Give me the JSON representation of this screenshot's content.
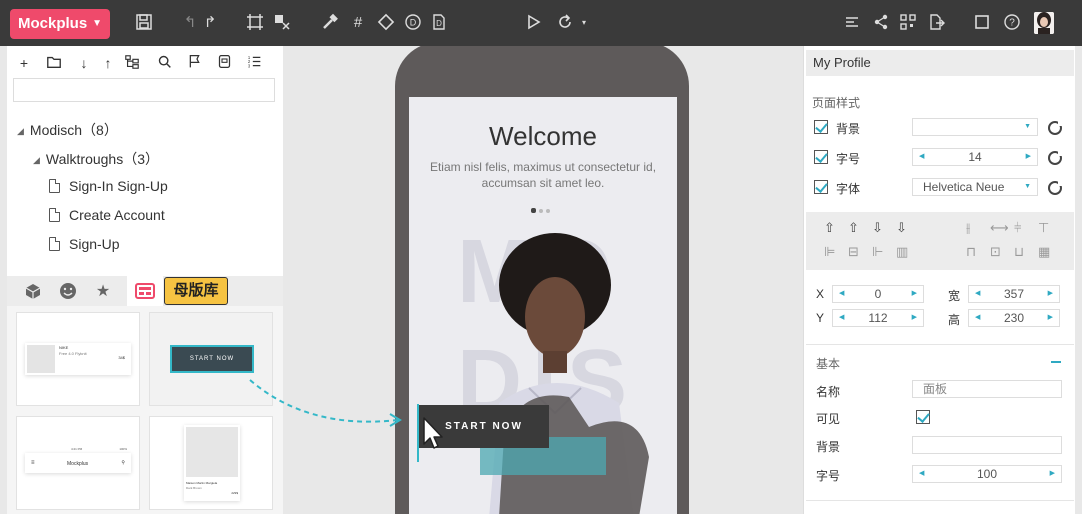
{
  "app": {
    "brand": "Mockplus",
    "colors": {
      "brand": "#ef4a6b",
      "toolbar": "#3a3a3a",
      "accent": "#2fa9c2",
      "badge": "#f6c342"
    },
    "toolbar_icons": [
      "save-icon",
      "undo-icon",
      "redo-icon",
      "frame-icon",
      "component-icon",
      "hammer-icon",
      "crop-icon",
      "eraser-icon",
      "d-icon",
      "document-d-icon",
      "play-icon",
      "sync-icon",
      "align-icon",
      "share-icon",
      "qr-icon",
      "export-icon",
      "fullscreen-icon",
      "help-icon"
    ]
  },
  "tree": {
    "root": "Modisch（8）",
    "group": "Walktroughs（3）",
    "pages": [
      "Sign-In Sign-Up",
      "Create Account",
      "Sign-Up"
    ]
  },
  "library": {
    "badge": "母版库",
    "cards": [
      {
        "title": "NIKE",
        "sub": "Free 4.0 Flyknit",
        "price": "34$"
      },
      {
        "button": "START NOW"
      },
      {
        "status": "4:21 PM",
        "battery": "100%",
        "title": "Mockplus"
      },
      {
        "name": "Maison Martin Margiela",
        "sub": "Dark Brown",
        "price": "229$"
      }
    ]
  },
  "canvas": {
    "welcome": "Welcome",
    "subtitle": "Etiam nisl felis, maximus ut consectetur id, accumsan sit amet leo.",
    "bg_letters": "MO DIS",
    "start_button": "START NOW"
  },
  "props": {
    "title": "My Profile",
    "page_style": "页面样式",
    "background": "背景",
    "font_size": "字号",
    "font_size_value": "14",
    "font": "字体",
    "font_value": "Helvetica Neue",
    "x_label": "X",
    "x_value": "0",
    "y_label": "Y",
    "y_value": "112",
    "w_label": "宽",
    "w_value": "357",
    "h_label": "高",
    "h_value": "230",
    "basic": "基本",
    "name_label": "名称",
    "name_placeholder": "面板",
    "visible": "可见",
    "bg2": "背景",
    "size2": "字号",
    "size2_value": "100"
  }
}
